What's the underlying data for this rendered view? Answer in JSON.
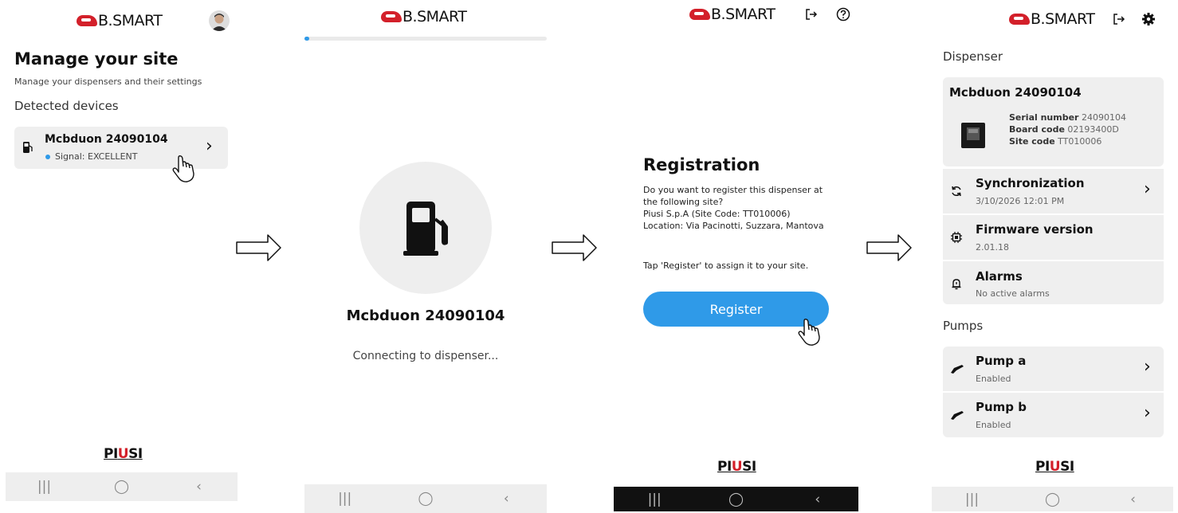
{
  "app": {
    "logo_text": "B.SMART",
    "brand_footer": {
      "pre": "PI",
      "mid": "U",
      "post": "SI"
    }
  },
  "screen1": {
    "title": "Manage your site",
    "subtitle": "Manage your dispensers and their settings",
    "section": "Detected devices",
    "device": {
      "name": "Mcbduon 24090104",
      "signal": "Signal: EXCELLENT"
    },
    "nav": {
      "recents": "|||",
      "home": "◯",
      "back": "‹"
    }
  },
  "screen2": {
    "device_name": "Mcbduon 24090104",
    "status": "Connecting to dispenser...",
    "progress": 0.02,
    "nav": {
      "recents": "|||",
      "home": "◯",
      "back": "‹"
    }
  },
  "screen3": {
    "title": "Registration",
    "body": "Do you want to register this dispenser at the following site?\nPiusi S.p.A (Site Code: TT010006)\nLocation: Via Pacinotti, Suzzara, Mantova",
    "hint": "Tap 'Register' to assign it to your site.",
    "register_label": "Register",
    "nav": {
      "recents": "|||",
      "home": "◯",
      "back": "‹"
    }
  },
  "screen4": {
    "dispenser_header": "Dispenser",
    "dispenser_name": "Mcbduon 24090104",
    "serial_label": "Serial number",
    "serial_value": "24090104",
    "board_label": "Board code",
    "board_value": "02193400D",
    "site_label": "Site code",
    "site_value": "TT010006",
    "sync": {
      "title": "Synchronization",
      "value": "3/10/2026 12:01 PM"
    },
    "firmware": {
      "title": "Firmware version",
      "value": "2.01.18"
    },
    "alarms": {
      "title": "Alarms",
      "value": "No active alarms"
    },
    "pumps_header": "Pumps",
    "pumps": [
      {
        "title": "Pump a",
        "status": "Enabled"
      },
      {
        "title": "Pump b",
        "status": "Enabled"
      }
    ],
    "nav": {
      "recents": "|||",
      "home": "◯",
      "back": "‹"
    }
  },
  "colors": {
    "accent": "#2f9ae8",
    "brand_red": "#d3202a",
    "card": "#efefef",
    "navbar": "#eeeeee"
  }
}
